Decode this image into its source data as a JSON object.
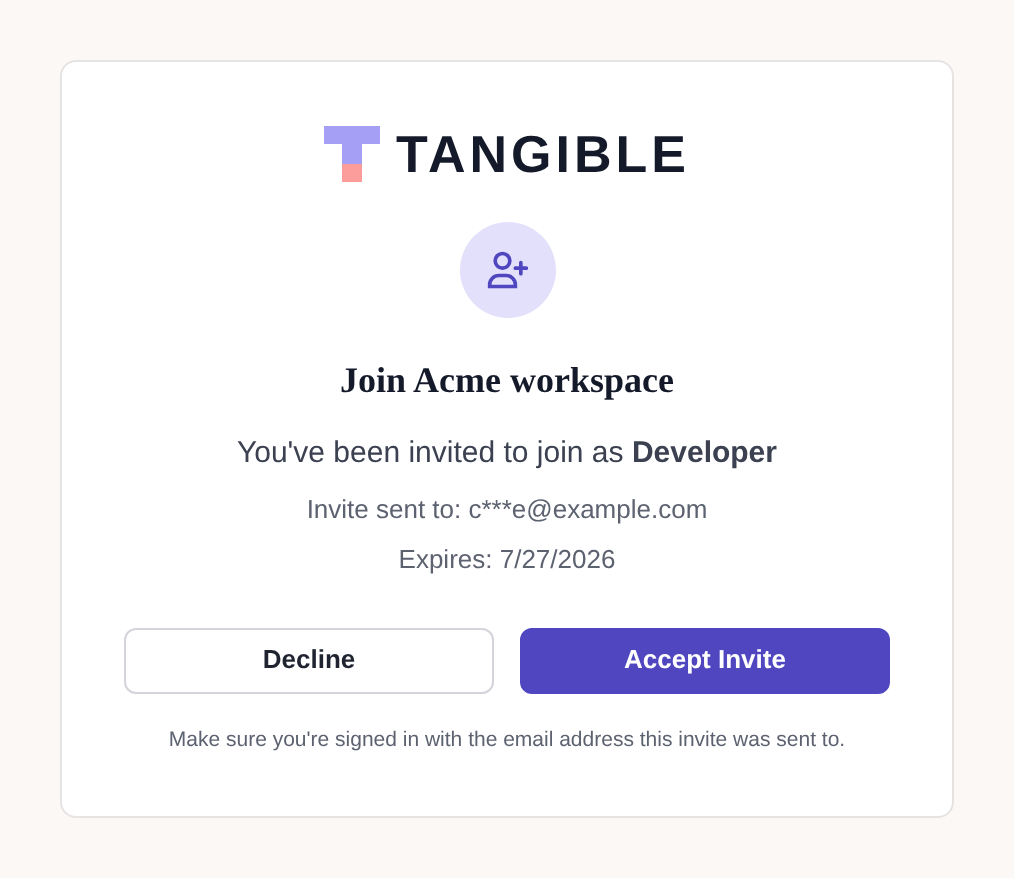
{
  "logo": {
    "wordmark": "TANGIBLE"
  },
  "title": "Join Acme workspace",
  "subtitle": "You've been invited to join as **Developer**",
  "details": [
    "Invite sent to: c***e@example.com",
    "Expires: 7/27/2026"
  ],
  "buttons": [
    {
      "label": "Decline",
      "kind": "secondary"
    },
    {
      "label": "Accept Invite",
      "kind": "primary"
    }
  ],
  "note": "Make sure you're signed in with the email address this invite was sent to."
}
